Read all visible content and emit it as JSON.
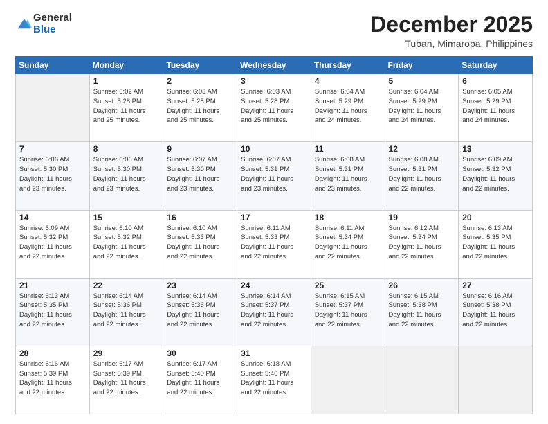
{
  "logo": {
    "general": "General",
    "blue": "Blue"
  },
  "title": "December 2025",
  "location": "Tuban, Mimaropa, Philippines",
  "days_of_week": [
    "Sunday",
    "Monday",
    "Tuesday",
    "Wednesday",
    "Thursday",
    "Friday",
    "Saturday"
  ],
  "weeks": [
    [
      {
        "day": "",
        "info": ""
      },
      {
        "day": "1",
        "info": "Sunrise: 6:02 AM\nSunset: 5:28 PM\nDaylight: 11 hours\nand 25 minutes."
      },
      {
        "day": "2",
        "info": "Sunrise: 6:03 AM\nSunset: 5:28 PM\nDaylight: 11 hours\nand 25 minutes."
      },
      {
        "day": "3",
        "info": "Sunrise: 6:03 AM\nSunset: 5:28 PM\nDaylight: 11 hours\nand 25 minutes."
      },
      {
        "day": "4",
        "info": "Sunrise: 6:04 AM\nSunset: 5:29 PM\nDaylight: 11 hours\nand 24 minutes."
      },
      {
        "day": "5",
        "info": "Sunrise: 6:04 AM\nSunset: 5:29 PM\nDaylight: 11 hours\nand 24 minutes."
      },
      {
        "day": "6",
        "info": "Sunrise: 6:05 AM\nSunset: 5:29 PM\nDaylight: 11 hours\nand 24 minutes."
      }
    ],
    [
      {
        "day": "7",
        "info": "Sunrise: 6:06 AM\nSunset: 5:30 PM\nDaylight: 11 hours\nand 23 minutes."
      },
      {
        "day": "8",
        "info": "Sunrise: 6:06 AM\nSunset: 5:30 PM\nDaylight: 11 hours\nand 23 minutes."
      },
      {
        "day": "9",
        "info": "Sunrise: 6:07 AM\nSunset: 5:30 PM\nDaylight: 11 hours\nand 23 minutes."
      },
      {
        "day": "10",
        "info": "Sunrise: 6:07 AM\nSunset: 5:31 PM\nDaylight: 11 hours\nand 23 minutes."
      },
      {
        "day": "11",
        "info": "Sunrise: 6:08 AM\nSunset: 5:31 PM\nDaylight: 11 hours\nand 23 minutes."
      },
      {
        "day": "12",
        "info": "Sunrise: 6:08 AM\nSunset: 5:31 PM\nDaylight: 11 hours\nand 22 minutes."
      },
      {
        "day": "13",
        "info": "Sunrise: 6:09 AM\nSunset: 5:32 PM\nDaylight: 11 hours\nand 22 minutes."
      }
    ],
    [
      {
        "day": "14",
        "info": "Sunrise: 6:09 AM\nSunset: 5:32 PM\nDaylight: 11 hours\nand 22 minutes."
      },
      {
        "day": "15",
        "info": "Sunrise: 6:10 AM\nSunset: 5:32 PM\nDaylight: 11 hours\nand 22 minutes."
      },
      {
        "day": "16",
        "info": "Sunrise: 6:10 AM\nSunset: 5:33 PM\nDaylight: 11 hours\nand 22 minutes."
      },
      {
        "day": "17",
        "info": "Sunrise: 6:11 AM\nSunset: 5:33 PM\nDaylight: 11 hours\nand 22 minutes."
      },
      {
        "day": "18",
        "info": "Sunrise: 6:11 AM\nSunset: 5:34 PM\nDaylight: 11 hours\nand 22 minutes."
      },
      {
        "day": "19",
        "info": "Sunrise: 6:12 AM\nSunset: 5:34 PM\nDaylight: 11 hours\nand 22 minutes."
      },
      {
        "day": "20",
        "info": "Sunrise: 6:13 AM\nSunset: 5:35 PM\nDaylight: 11 hours\nand 22 minutes."
      }
    ],
    [
      {
        "day": "21",
        "info": "Sunrise: 6:13 AM\nSunset: 5:35 PM\nDaylight: 11 hours\nand 22 minutes."
      },
      {
        "day": "22",
        "info": "Sunrise: 6:14 AM\nSunset: 5:36 PM\nDaylight: 11 hours\nand 22 minutes."
      },
      {
        "day": "23",
        "info": "Sunrise: 6:14 AM\nSunset: 5:36 PM\nDaylight: 11 hours\nand 22 minutes."
      },
      {
        "day": "24",
        "info": "Sunrise: 6:14 AM\nSunset: 5:37 PM\nDaylight: 11 hours\nand 22 minutes."
      },
      {
        "day": "25",
        "info": "Sunrise: 6:15 AM\nSunset: 5:37 PM\nDaylight: 11 hours\nand 22 minutes."
      },
      {
        "day": "26",
        "info": "Sunrise: 6:15 AM\nSunset: 5:38 PM\nDaylight: 11 hours\nand 22 minutes."
      },
      {
        "day": "27",
        "info": "Sunrise: 6:16 AM\nSunset: 5:38 PM\nDaylight: 11 hours\nand 22 minutes."
      }
    ],
    [
      {
        "day": "28",
        "info": "Sunrise: 6:16 AM\nSunset: 5:39 PM\nDaylight: 11 hours\nand 22 minutes."
      },
      {
        "day": "29",
        "info": "Sunrise: 6:17 AM\nSunset: 5:39 PM\nDaylight: 11 hours\nand 22 minutes."
      },
      {
        "day": "30",
        "info": "Sunrise: 6:17 AM\nSunset: 5:40 PM\nDaylight: 11 hours\nand 22 minutes."
      },
      {
        "day": "31",
        "info": "Sunrise: 6:18 AM\nSunset: 5:40 PM\nDaylight: 11 hours\nand 22 minutes."
      },
      {
        "day": "",
        "info": ""
      },
      {
        "day": "",
        "info": ""
      },
      {
        "day": "",
        "info": ""
      }
    ]
  ]
}
